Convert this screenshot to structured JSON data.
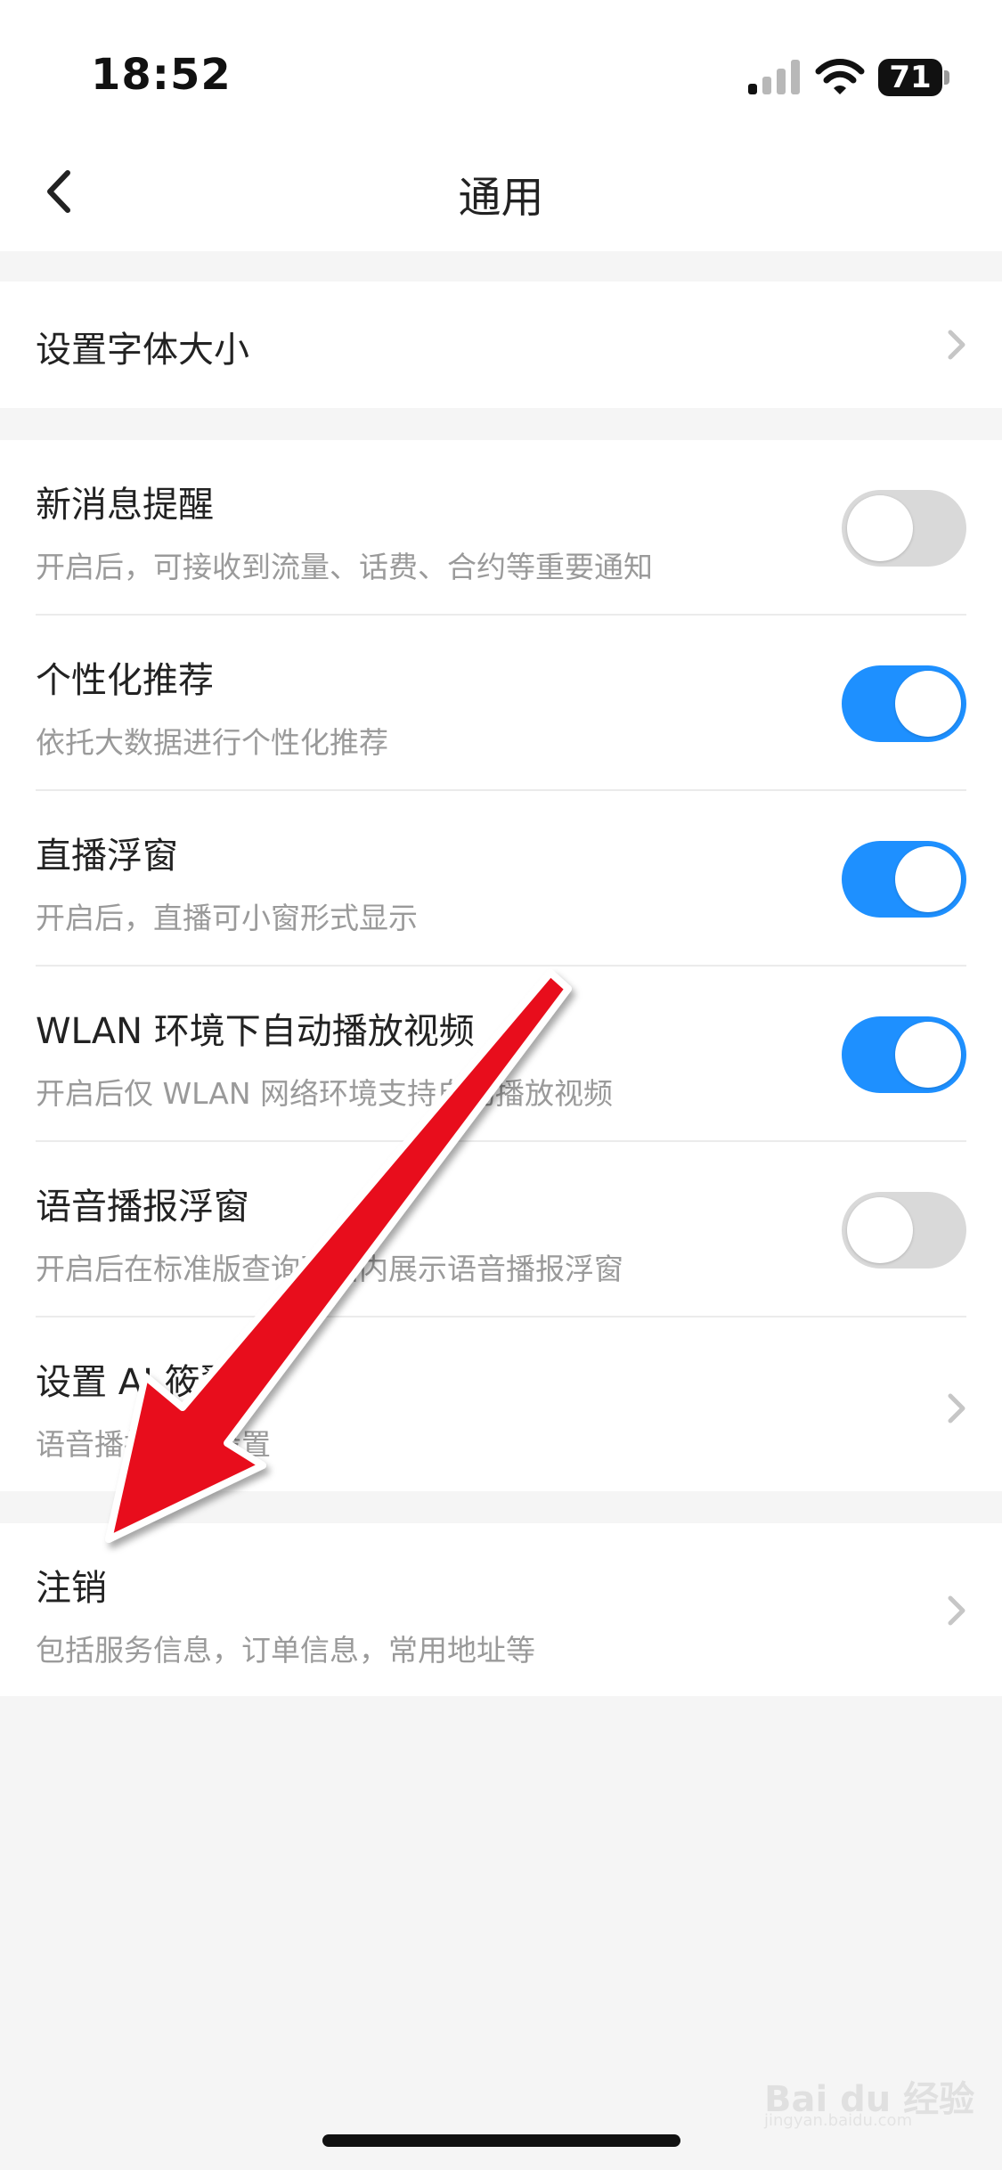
{
  "status_bar": {
    "time": "18:52",
    "battery_level": "71",
    "icons": [
      "cellular-signal-icon",
      "wifi-icon",
      "battery-icon"
    ]
  },
  "nav": {
    "back_icon": "chevron-left-icon",
    "title": "通用"
  },
  "font_section": {
    "title": "设置字体大小",
    "trailing_icon": "chevron-right-icon"
  },
  "settings": [
    {
      "title": "新消息提醒",
      "subtitle": "开启后，可接收到流量、话费、合约等重要通知",
      "control": "toggle",
      "enabled": false
    },
    {
      "title": "个性化推荐",
      "subtitle": "依托大数据进行个性化推荐",
      "control": "toggle",
      "enabled": true
    },
    {
      "title": "直播浮窗",
      "subtitle": "开启后，直播可小窗形式显示",
      "control": "toggle",
      "enabled": true
    },
    {
      "title": "WLAN 环境下自动播放视频",
      "subtitle": "开启后仅 WLAN 网络环境支持自动播放视频",
      "control": "toggle",
      "enabled": true
    },
    {
      "title": "语音播报浮窗",
      "subtitle": "开启后在标准版查询页面内展示语音播报浮窗",
      "control": "toggle",
      "enabled": false
    },
    {
      "title": "设置 AI 筱翼",
      "subtitle": "语音播报相关设置",
      "control": "chevron"
    }
  ],
  "cancel_section": {
    "title": "注销",
    "subtitle": "包括服务信息，订单信息，常用地址等",
    "trailing_icon": "chevron-right-icon"
  },
  "overlay": {
    "annotation_icon": "red-arrow-icon"
  },
  "watermark": {
    "text": "Bai du 经验",
    "sub": "jingyan.baidu.com"
  },
  "colors": {
    "toggle_on": "#1e90ff",
    "toggle_off": "#d9d9d9",
    "annotation_arrow": "#e8101a",
    "page_background": "#f5f5f5"
  }
}
